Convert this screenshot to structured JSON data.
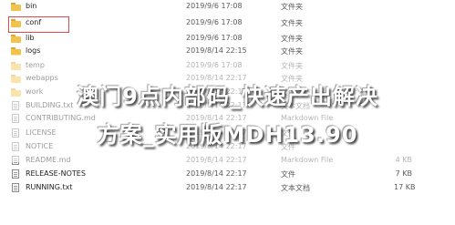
{
  "files": [
    {
      "name": "bin",
      "date": "2019/9/6 17:08",
      "type": "文件夹",
      "size": "",
      "icon": "folder-icon"
    },
    {
      "name": "conf",
      "date": "2019/9/6 17:08",
      "type": "文件夹",
      "size": "",
      "icon": "folder-icon"
    },
    {
      "name": "lib",
      "date": "2019/9/6 17:08",
      "type": "文件夹",
      "size": "",
      "icon": "folder-icon"
    },
    {
      "name": "logs",
      "date": "2019/8/14 22:15",
      "type": "文件夹",
      "size": "",
      "icon": "folder-icon"
    },
    {
      "name": "temp",
      "date": "2019/9/6 17:08",
      "type": "文件夹",
      "size": "",
      "icon": "folder-icon"
    },
    {
      "name": "webapps",
      "date": "2019/8/14 22:17",
      "type": "文件夹",
      "size": "",
      "icon": "folder-icon"
    },
    {
      "name": "work",
      "date": "2019/8/14 22:15",
      "type": "文件夹",
      "size": "",
      "icon": "folder-icon"
    },
    {
      "name": "BUILDING.txt",
      "date": "2019/8/14 22:17",
      "type": "文本文档",
      "size": "",
      "icon": "doc-icon"
    },
    {
      "name": "CONTRIBUTING.md",
      "date": "2019/8/14 22:17",
      "type": "Markdown File",
      "size": "",
      "icon": "doc-icon"
    },
    {
      "name": "LICENSE",
      "date": "2019/8/14 22:17",
      "type": "文件",
      "size": "",
      "icon": "doc-icon"
    },
    {
      "name": "NOTICE",
      "date": "2019/8/14 22:17",
      "type": "文件",
      "size": "",
      "icon": "doc-icon"
    },
    {
      "name": "README.md",
      "date": "2019/8/14 22:17",
      "type": "Markdown File",
      "size": "4 KB",
      "icon": "doc-icon"
    },
    {
      "name": "RELEASE-NOTES",
      "date": "2019/8/14 22:17",
      "type": "文件",
      "size": "7 KB",
      "icon": "doc-icon"
    },
    {
      "name": "RUNNING.txt",
      "date": "2019/8/14 22:17",
      "type": "文本文档",
      "size": "17 KB",
      "icon": "doc-icon"
    }
  ],
  "watermark": {
    "line1": "澳门9点内部码_快速产出解决",
    "line2": "方案_实用版MDH13.90"
  }
}
